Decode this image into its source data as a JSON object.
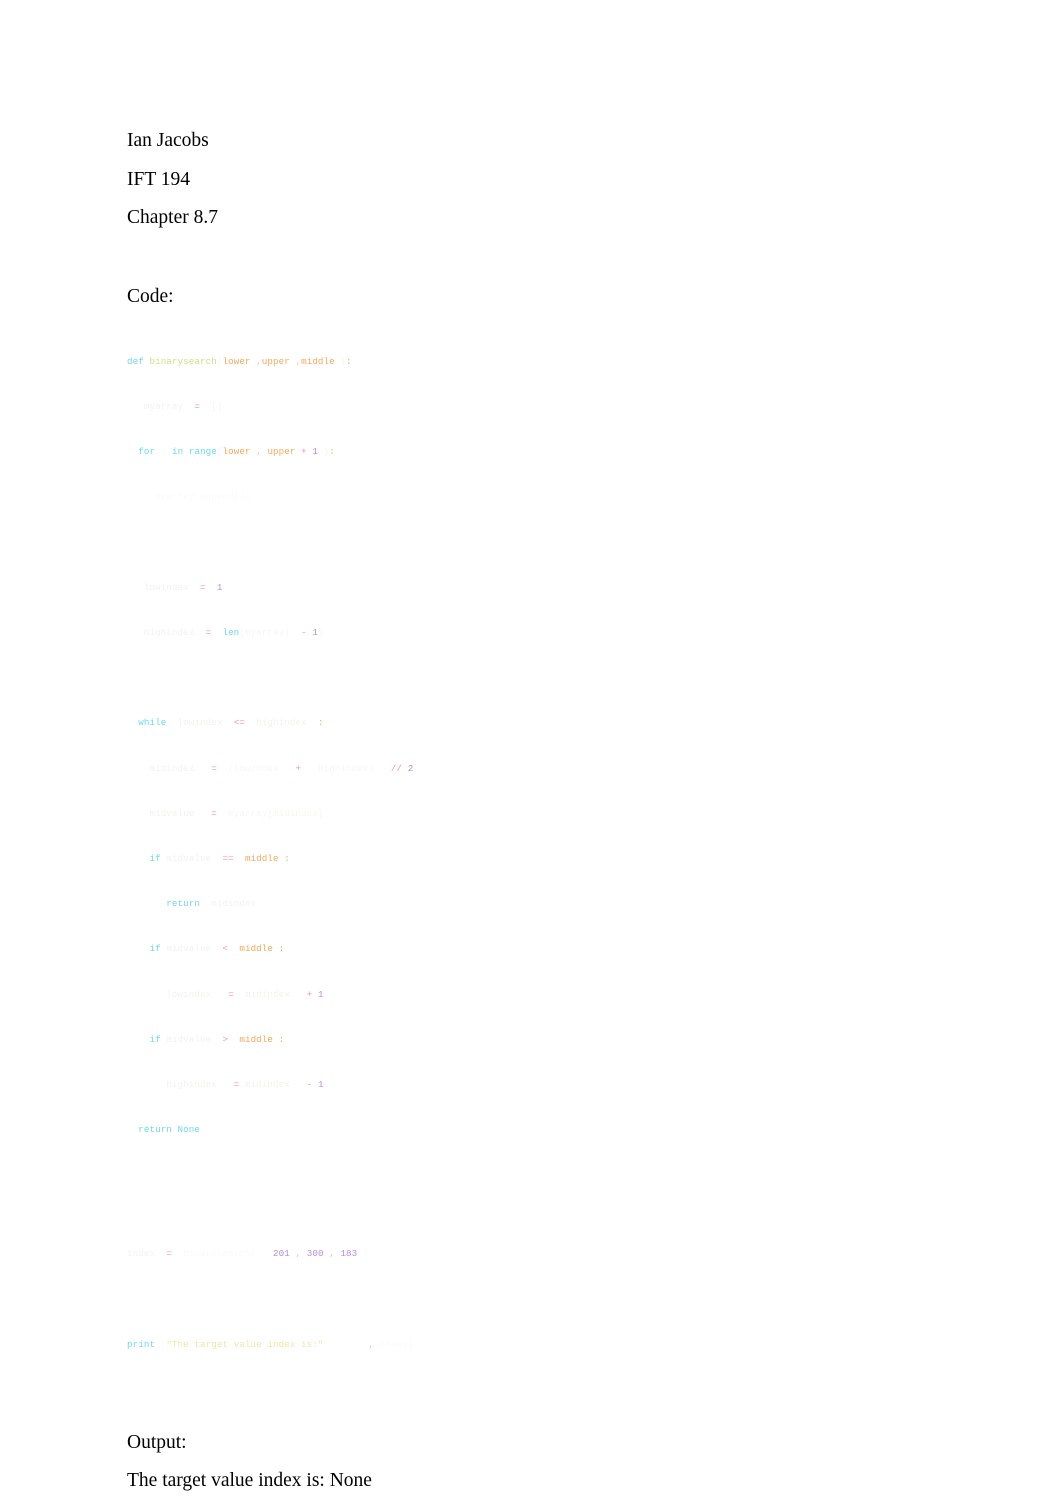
{
  "document": {
    "header_lines": [
      "Ian Jacobs",
      "IFT 194",
      "Chapter 8.7"
    ],
    "code_heading": "Code:",
    "output_heading": "Output:",
    "output_text": "The target value index is: None"
  },
  "code": {
    "language": "python",
    "full_text": "def binarysearch(lower, upper, middle):\n    myarray = []\n    for i in range(lower, upper + 1):\n        myarray.append(i)\n\n    lowindex = 1\n    highindex = len(myarray) - 1\n\n    while lowindex <= highindex:\n        midindex = (lowindex + highindex) // 2\n        midvalue = myarray[midindex]\n        if midvalue == middle:\n            return midindex\n        if midvalue < middle:\n            lowindex = midindex + 1\n        if midvalue > middle:\n            highindex = midindex - 1\n    return None\n\nindex = binarysearch(201, 300, 183)\nprint(\"The target value index is:\", index)",
    "lines": [
      {
        "n": 1,
        "text": "def binarysearch(lower ,upper ,middle ):"
      },
      {
        "n": 2,
        "text": "    myarray = []"
      },
      {
        "n": 3,
        "text": "    for i in range(lower , upper + 1 ):"
      },
      {
        "n": 4,
        "text": "        myarray.append(i)"
      },
      {
        "n": 5,
        "text": ""
      },
      {
        "n": 6,
        "text": "    lowindex = 1"
      },
      {
        "n": 7,
        "text": "    highindex = len(myarray) - 1"
      },
      {
        "n": 8,
        "text": ""
      },
      {
        "n": 9,
        "text": "    while lowindex <= highindex :"
      },
      {
        "n": 10,
        "text": "        midindex = (lowindex + highindex) // 2"
      },
      {
        "n": 11,
        "text": "        midvalue = myarray[midindex]"
      },
      {
        "n": 12,
        "text": "        if midvalue == middle :"
      },
      {
        "n": 13,
        "text": "            return midindex"
      },
      {
        "n": 14,
        "text": "        if midvalue < middle :"
      },
      {
        "n": 15,
        "text": "            lowindex = midindex + 1"
      },
      {
        "n": 16,
        "text": "        if midvalue > middle :"
      },
      {
        "n": 17,
        "text": "            highindex = midindex - 1"
      },
      {
        "n": 18,
        "text": "    return None"
      },
      {
        "n": 19,
        "text": ""
      },
      {
        "n": 20,
        "text": "index = binarysearch( 201 , 300 , 183 )"
      },
      {
        "n": 21,
        "text": "print (\"The target value index is:\" , index)"
      }
    ],
    "tokens": {
      "keywords": [
        "def",
        "for",
        "in",
        "range",
        "while",
        "if",
        "return",
        "print",
        "len",
        "None"
      ],
      "function_name": "binarysearch",
      "parameters": [
        "lower",
        "upper",
        "middle"
      ],
      "variables": [
        "myarray",
        "i",
        "lowindex",
        "highindex",
        "midindex",
        "midvalue",
        "index"
      ],
      "numbers": [
        "1",
        "1",
        "2",
        "1",
        "1",
        "201",
        "300",
        "183"
      ],
      "string_literal": "\"The target value index is:\"",
      "call_args": [
        "201",
        "300",
        "183"
      ]
    },
    "colors": {
      "keyword": "#6fd8ee",
      "function_name": "#cfe08a",
      "parameter": "#f2a95c",
      "operator": "#f58fb4",
      "number": "#b98ce0",
      "string": "#f0e6a8",
      "identifier": "#f2f2ee",
      "page_background": "#ffffff",
      "body_text": "#000000"
    }
  }
}
